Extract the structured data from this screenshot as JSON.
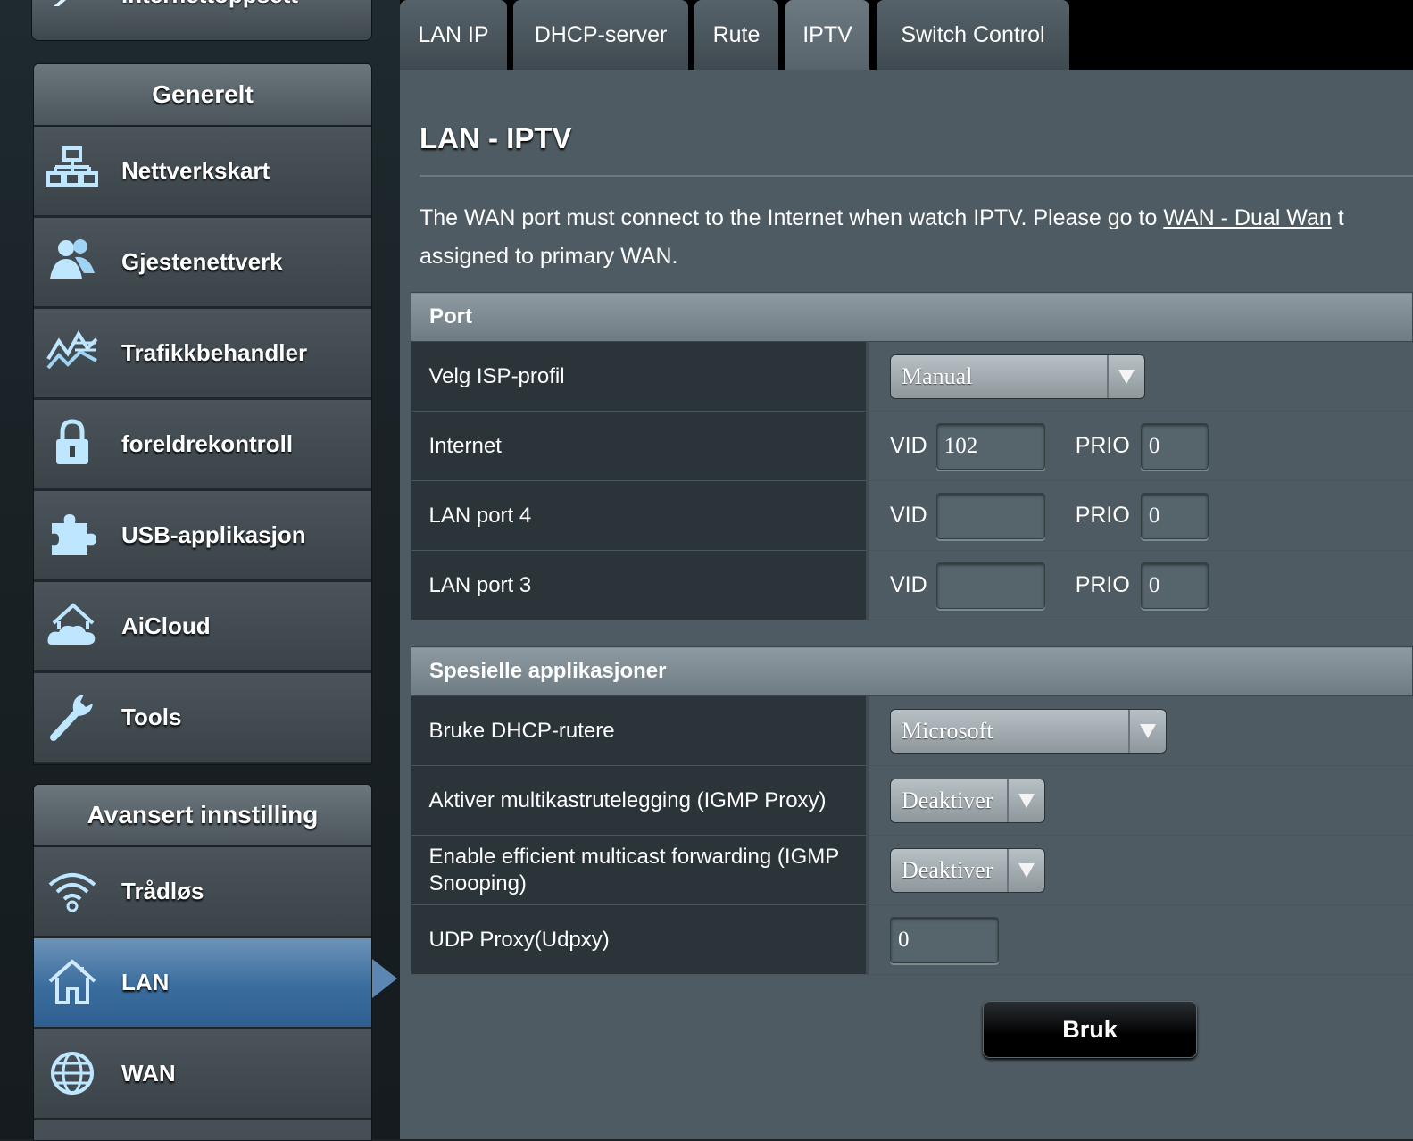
{
  "sidebar": {
    "top_stub_label": "Internettoppsett",
    "general_header": "Generelt",
    "general_items": [
      {
        "label": "Nettverkskart",
        "icon": "network-map-icon"
      },
      {
        "label": "Gjestenettverk",
        "icon": "guest-network-icon"
      },
      {
        "label": "Trafikkbehandler",
        "icon": "traffic-manager-icon"
      },
      {
        "label": "foreldrekontroll",
        "icon": "lock-icon"
      },
      {
        "label": "USB-applikasjon",
        "icon": "puzzle-icon"
      },
      {
        "label": "AiCloud",
        "icon": "cloud-home-icon"
      },
      {
        "label": "Tools",
        "icon": "wrench-icon"
      }
    ],
    "advanced_header": "Avansert innstilling",
    "advanced_items": [
      {
        "label": "Trådløs",
        "icon": "wifi-icon"
      },
      {
        "label": "LAN",
        "icon": "home-icon",
        "active": true
      },
      {
        "label": "WAN",
        "icon": "globe-icon"
      }
    ]
  },
  "tabs": [
    {
      "label": "LAN IP"
    },
    {
      "label": "DHCP-server"
    },
    {
      "label": "Rute"
    },
    {
      "label": "IPTV",
      "active": true
    },
    {
      "label": "Switch Control"
    }
  ],
  "main": {
    "title": "LAN - IPTV",
    "description_before_link": "The WAN port must connect to the Internet when watch IPTV. Please go to ",
    "description_link": "WAN - Dual Wan",
    "description_after_link": " t",
    "description_line2": "assigned to primary WAN."
  },
  "port_section": {
    "header": "Port",
    "isp_profile": {
      "label": "Velg ISP-profil",
      "value": "Manual"
    },
    "vid_label": "VID",
    "prio_label": "PRIO",
    "rows": [
      {
        "label": "Internet",
        "vid": "102",
        "prio": "0"
      },
      {
        "label": "LAN port 4",
        "vid": "",
        "prio": "0"
      },
      {
        "label": "LAN port 3",
        "vid": "",
        "prio": "0"
      }
    ]
  },
  "special_section": {
    "header": "Spesielle applikasjoner",
    "dhcp": {
      "label": "Bruke DHCP-rutere",
      "value": "Microsoft"
    },
    "igmp_proxy": {
      "label": "Aktiver multikastrutelegging (IGMP Proxy)",
      "value": "Deaktiver"
    },
    "igmp_snooping": {
      "label_line1": "Enable efficient multicast forwarding (IGMP",
      "label_line2": "Snooping)",
      "value": "Deaktiver"
    },
    "udpxy": {
      "label": "UDP Proxy(Udpxy)",
      "value": "0"
    }
  },
  "apply_button": "Bruk",
  "colors": {
    "active_item": "#3a6d9e",
    "header_bar": "#7d8a91",
    "panel": "#4e5b62"
  }
}
